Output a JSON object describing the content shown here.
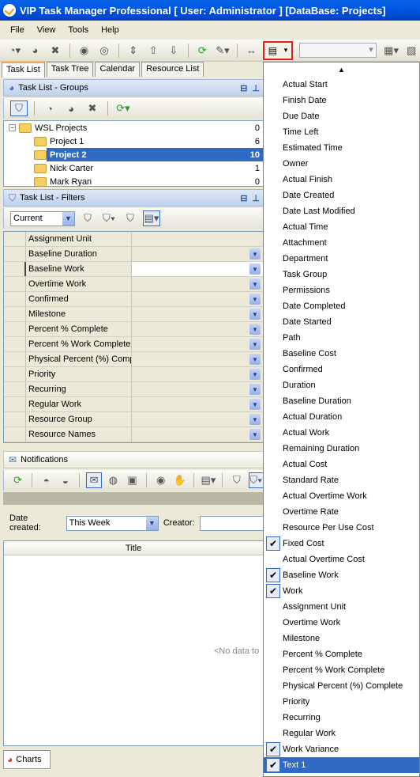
{
  "window": {
    "title": "VIP Task Manager Professional [ User: Administrator ] [DataBase: Projects]"
  },
  "menu": [
    "File",
    "View",
    "Tools",
    "Help"
  ],
  "tabs": [
    "Task List",
    "Task Tree",
    "Calendar",
    "Resource List"
  ],
  "groups_panel": {
    "title": "Task List - Groups",
    "tree": [
      {
        "label": "WSL Projects",
        "count": "0"
      },
      {
        "label": "Project 1",
        "count": "6"
      },
      {
        "label": "Project 2",
        "count": "10"
      },
      {
        "label": "Nick Carter",
        "count": "1"
      },
      {
        "label": "Mark Ryan",
        "count": "0"
      }
    ]
  },
  "filters_panel": {
    "title": "Task List - Filters",
    "current_filter": "Current",
    "rows": [
      "Assignment Unit",
      "Baseline Duration",
      "Baseline Work",
      "Overtime Work",
      "Confirmed",
      "Milestone",
      "Percent % Complete",
      "Percent % Work Complete",
      "Physical Percent (%) Comp",
      "Priority",
      "Recurring",
      "Regular Work",
      "Resource Group",
      "Resource Names"
    ]
  },
  "notifications": {
    "title": "Notifications",
    "date_label": "Date created:",
    "date_value": "This Week",
    "creator_label": "Creator:",
    "column_title": "Title",
    "no_data": "<No data to"
  },
  "charts_tab": "Charts",
  "dropdown_items": [
    {
      "label": "Actual Start",
      "checked": false
    },
    {
      "label": "Finish Date",
      "checked": false
    },
    {
      "label": "Due Date",
      "checked": false
    },
    {
      "label": "Time Left",
      "checked": false
    },
    {
      "label": "Estimated Time",
      "checked": false
    },
    {
      "label": "Owner",
      "checked": false
    },
    {
      "label": "Actual Finish",
      "checked": false
    },
    {
      "label": "Date Created",
      "checked": false
    },
    {
      "label": "Date Last Modified",
      "checked": false
    },
    {
      "label": "Actual Time",
      "checked": false
    },
    {
      "label": "Attachment",
      "checked": false
    },
    {
      "label": "Department",
      "checked": false
    },
    {
      "label": "Task Group",
      "checked": false
    },
    {
      "label": "Permissions",
      "checked": false
    },
    {
      "label": "Date Completed",
      "checked": false
    },
    {
      "label": "Date Started",
      "checked": false
    },
    {
      "label": "Path",
      "checked": false
    },
    {
      "label": "Baseline Cost",
      "checked": false
    },
    {
      "label": "Confirmed",
      "checked": false
    },
    {
      "label": "Duration",
      "checked": false
    },
    {
      "label": "Baseline Duration",
      "checked": false
    },
    {
      "label": "Actual Duration",
      "checked": false
    },
    {
      "label": "Actual Work",
      "checked": false
    },
    {
      "label": "Remaining Duration",
      "checked": false
    },
    {
      "label": "Actual Cost",
      "checked": false
    },
    {
      "label": "Standard Rate",
      "checked": false
    },
    {
      "label": "Actual Overtime Work",
      "checked": false
    },
    {
      "label": "Overtime Rate",
      "checked": false
    },
    {
      "label": "Resource Per Use Cost",
      "checked": false
    },
    {
      "label": "Fixed Cost",
      "checked": true
    },
    {
      "label": "Actual Overtime Cost",
      "checked": false
    },
    {
      "label": "Baseline Work",
      "checked": true
    },
    {
      "label": "Work",
      "checked": true
    },
    {
      "label": "Assignment Unit",
      "checked": false
    },
    {
      "label": "Overtime Work",
      "checked": false
    },
    {
      "label": "Milestone",
      "checked": false
    },
    {
      "label": "Percent % Complete",
      "checked": false
    },
    {
      "label": "Percent % Work Complete",
      "checked": false
    },
    {
      "label": "Physical Percent (%) Complete",
      "checked": false
    },
    {
      "label": "Priority",
      "checked": false
    },
    {
      "label": "Recurring",
      "checked": false
    },
    {
      "label": "Regular Work",
      "checked": false
    },
    {
      "label": "Work Variance",
      "checked": true
    },
    {
      "label": "Text 1",
      "checked": true,
      "highlighted": true
    }
  ]
}
